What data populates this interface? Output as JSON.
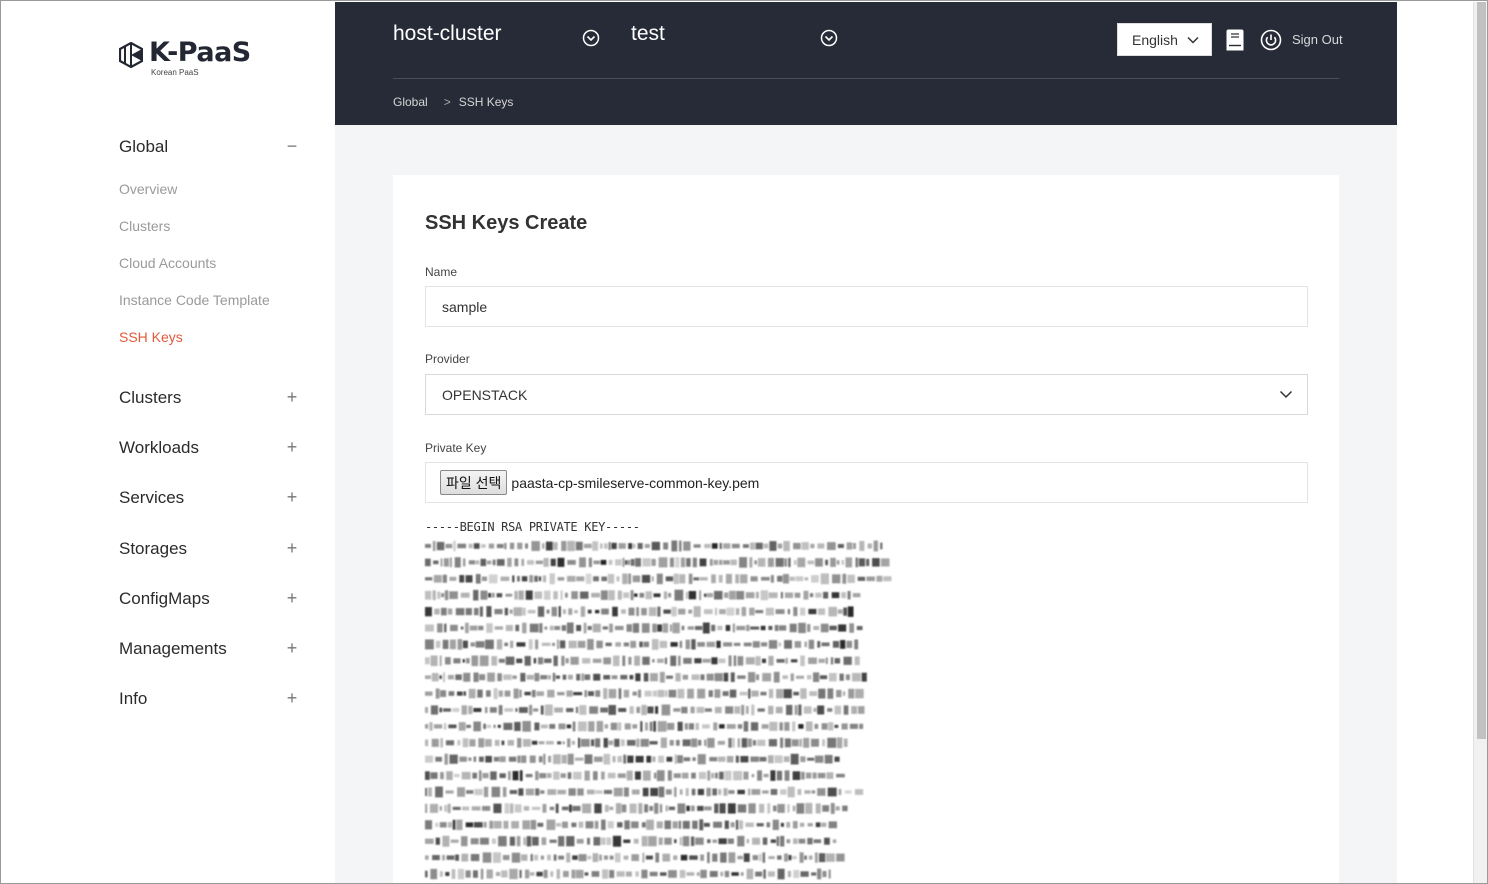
{
  "brand": {
    "title": "K-PaaS",
    "subtitle": "Korean PaaS"
  },
  "sidebar": {
    "global": {
      "label": "Global",
      "toggle": "−"
    },
    "global_items": [
      {
        "label": "Overview"
      },
      {
        "label": "Clusters"
      },
      {
        "label": "Cloud Accounts"
      },
      {
        "label": "Instance Code Template"
      },
      {
        "label": "SSH Keys",
        "active": true
      }
    ],
    "sections": [
      {
        "label": "Clusters",
        "toggle": "+"
      },
      {
        "label": "Workloads",
        "toggle": "+"
      },
      {
        "label": "Services",
        "toggle": "+"
      },
      {
        "label": "Storages",
        "toggle": "+"
      },
      {
        "label": "ConfigMaps",
        "toggle": "+"
      },
      {
        "label": "Managements",
        "toggle": "+"
      },
      {
        "label": "Info",
        "toggle": "+"
      }
    ]
  },
  "header": {
    "cluster_select": "host-cluster",
    "namespace_select": "test",
    "language": "English",
    "sign_out": "Sign Out",
    "breadcrumb": [
      "Global",
      "SSH Keys"
    ],
    "breadcrumb_sep": ">"
  },
  "form": {
    "title": "SSH Keys Create",
    "name_label": "Name",
    "name_value": "sample",
    "provider_label": "Provider",
    "provider_value": "OPENSTACK",
    "private_key_label": "Private Key",
    "file_button": "파일 선택",
    "file_name": "paasta-cp-smileserve-common-key.pem",
    "key_header": "-----BEGIN RSA PRIVATE KEY-----"
  },
  "colors": {
    "header_bg": "#272b37",
    "active_nav": "#e25a3a",
    "main_bg": "#f4f5f7"
  }
}
